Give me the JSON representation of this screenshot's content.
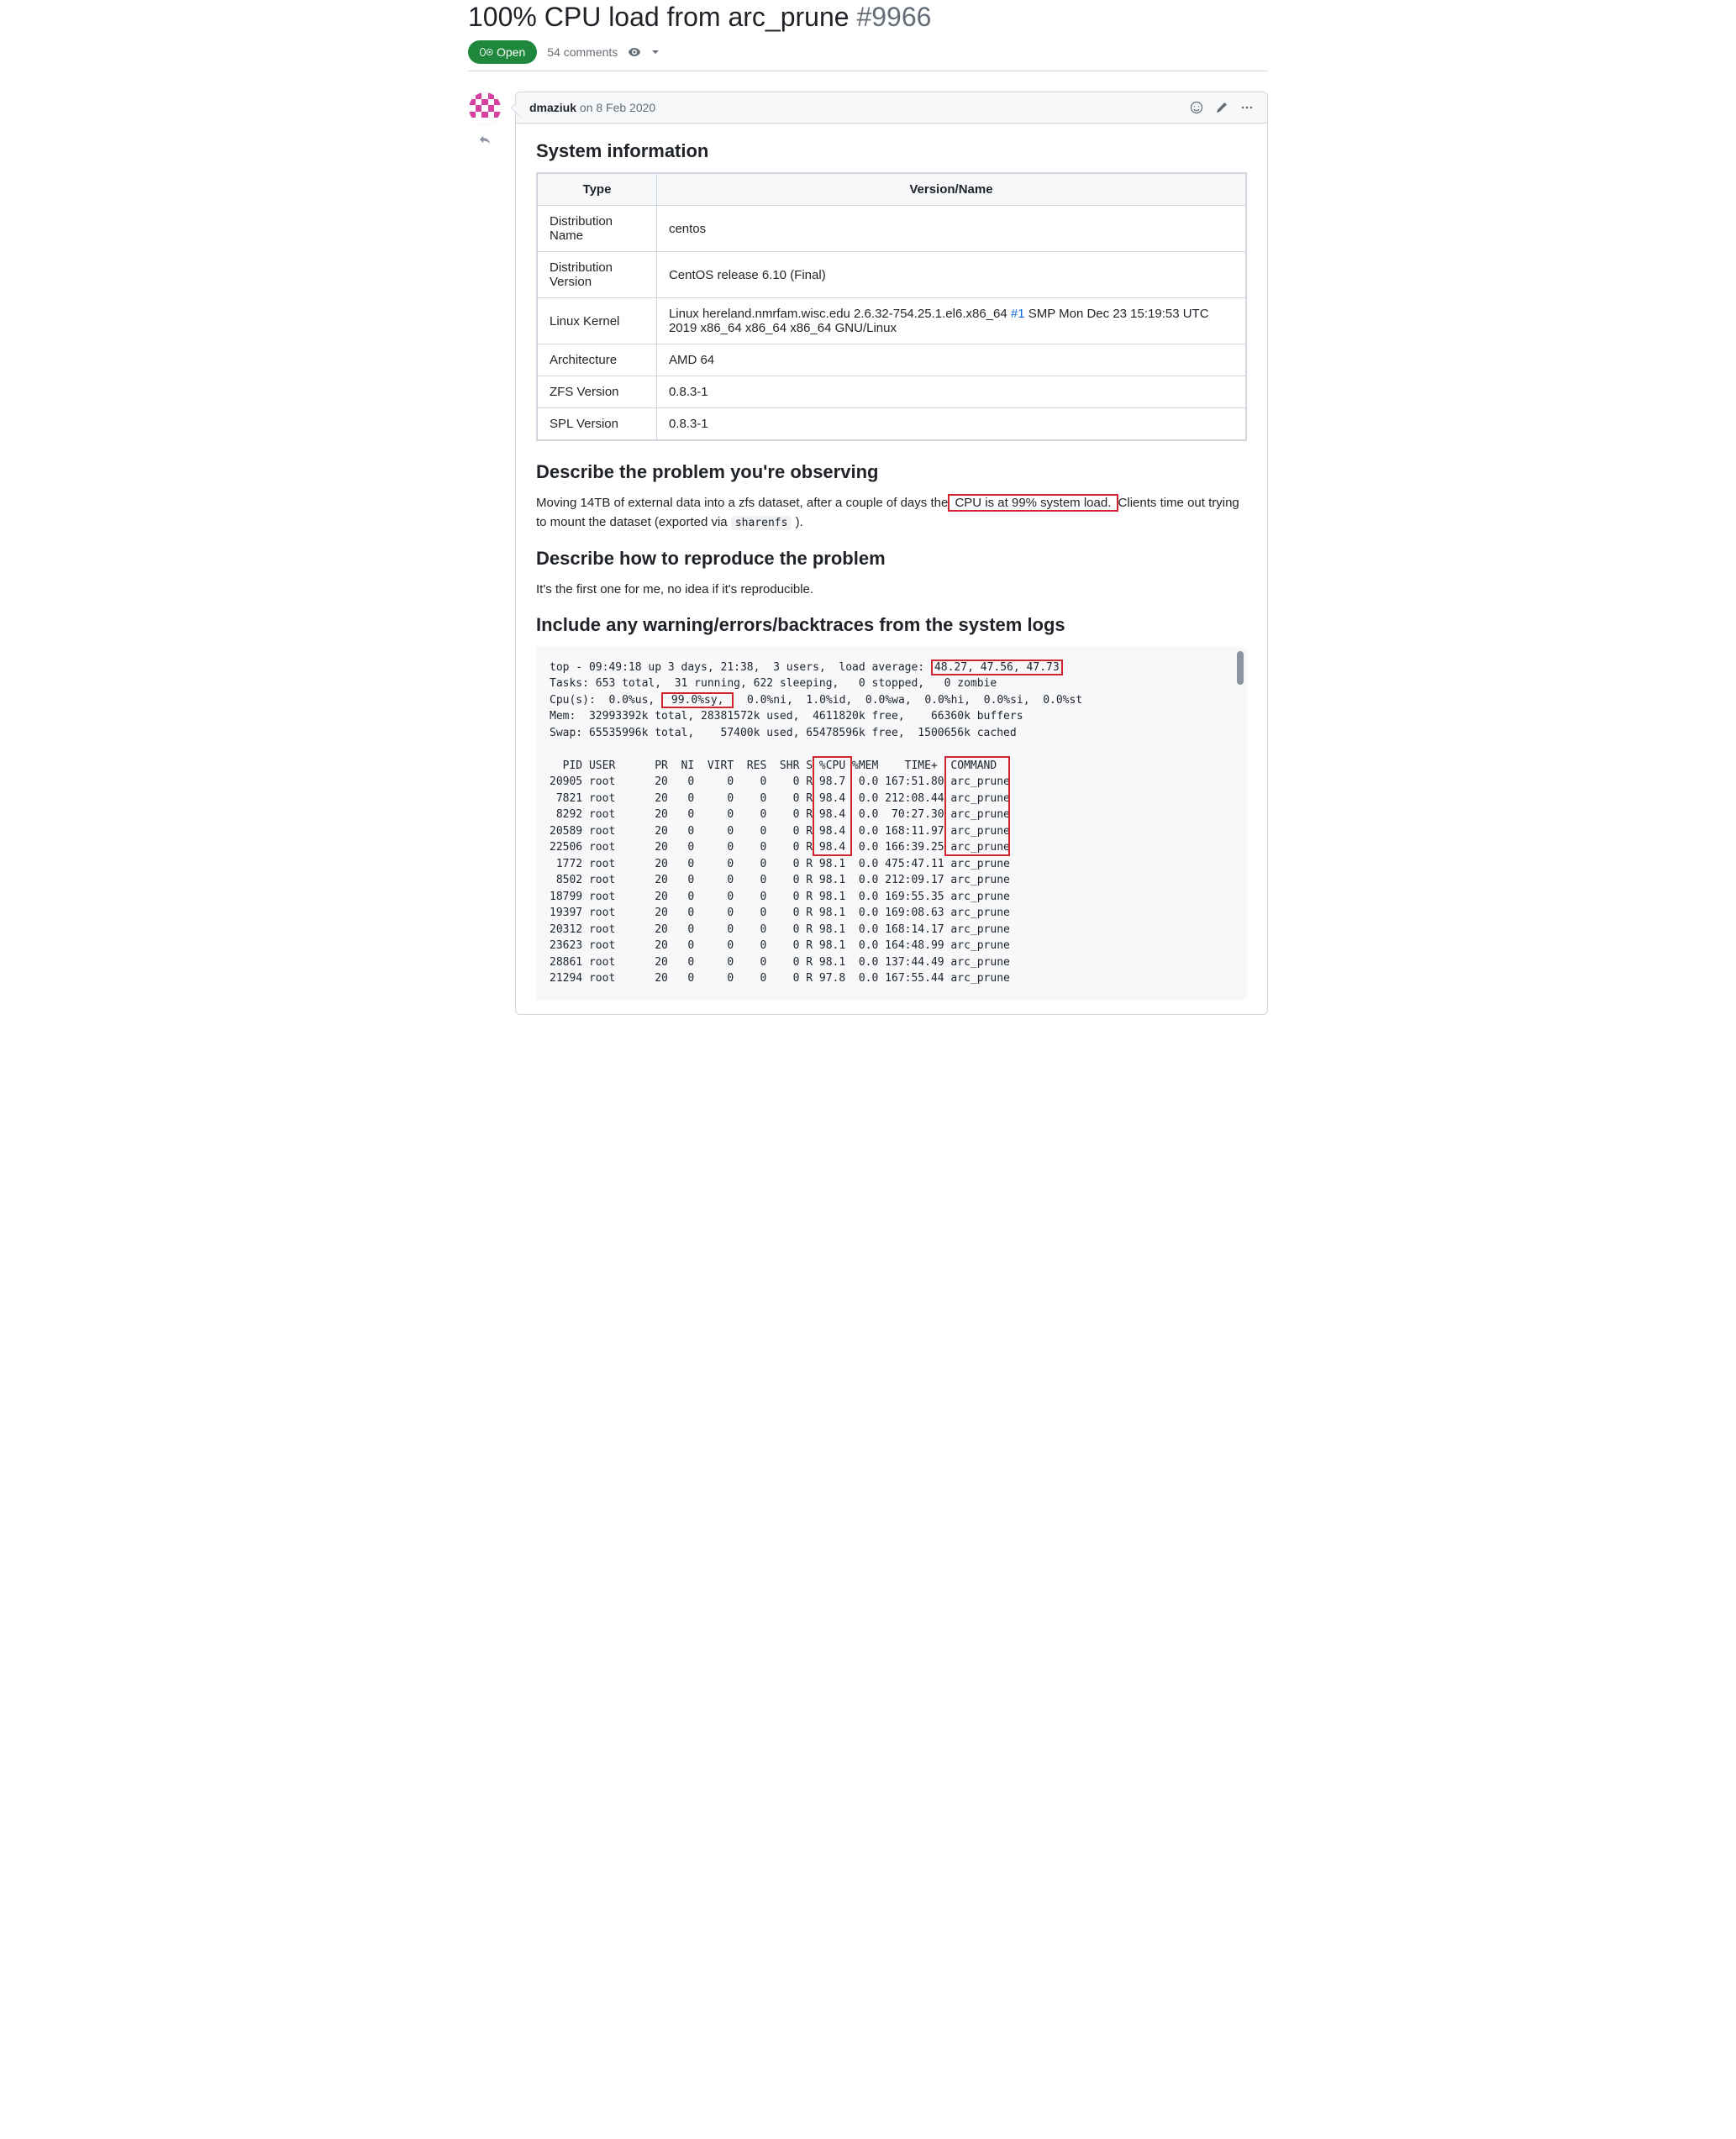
{
  "issue": {
    "title": "100% CPU load from arc_prune",
    "number": "#9966",
    "state": "Open",
    "comments": "54 comments"
  },
  "comment": {
    "author": "dmaziuk",
    "date": "on 8 Feb 2020"
  },
  "headings": {
    "sysinfo": "System information",
    "problem": "Describe the problem you're observing",
    "repro": "Describe how to reproduce the problem",
    "logs": "Include any warning/errors/backtraces from the system logs"
  },
  "table": {
    "h_type": "Type",
    "h_vn": "Version/Name",
    "r0_t": "Distribution Name",
    "r0_v": "centos",
    "r1_t": "Distribution Version",
    "r1_v": "CentOS release 6.10 (Final)",
    "r2_t": "Linux Kernel",
    "r2_v_a": "Linux hereland.nmrfam.wisc.edu 2.6.32-754.25.1.el6.x86_64 ",
    "r2_link": "#1",
    "r2_v_b": " SMP Mon Dec 23 15:19:53 UTC 2019 x86_64 x86_64 x86_64 GNU/Linux",
    "r3_t": "Architecture",
    "r3_v": "AMD 64",
    "r4_t": "ZFS Version",
    "r4_v": "0.8.3-1",
    "r5_t": "SPL Version",
    "r5_v": "0.8.3-1"
  },
  "problem": {
    "p1_a": "Moving 14TB of external data into a zfs dataset, after a couple of days the",
    "p1_hl": " CPU is at 99% system load. ",
    "p1_b": "Clients time out trying to mount the dataset (exported via ",
    "p1_code": "sharenfs",
    "p1_c": " )."
  },
  "repro": {
    "p": "It's the first one for me, no idea if it's reproducible."
  },
  "logs": {
    "l1_a": "top - 09:49:18 up 3 days, 21:38,  3 users,  load average: ",
    "l1_hl": "48.27, 47.56, 47.73",
    "l2": "Tasks: 653 total,  31 running, 622 sleeping,   0 stopped,   0 zombie",
    "l3_a": "Cpu(s):  0.0%us, ",
    "l3_hl": "99.0%sy,",
    "l3_b": "  0.0%ni,  1.0%id,  0.0%wa,  0.0%hi,  0.0%si,  0.0%st",
    "l4": "Mem:  32993392k total, 28381572k used,  4611820k free,    66360k buffers",
    "l5": "Swap: 65535996k total,    57400k used, 65478596k free,  1500656k cached",
    "hdr": "  PID USER      PR  NI  VIRT  RES  SHR S %CPU %MEM    TIME+  COMMAND",
    "rows": [
      "20905 root      20   0     0    0    0 R 98.7  0.0 167:51.80 arc_prune",
      " 7821 root      20   0     0    0    0 R 98.4  0.0 212:08.44 arc_prune",
      " 8292 root      20   0     0    0    0 R 98.4  0.0  70:27.30 arc_prune",
      "20589 root      20   0     0    0    0 R 98.4  0.0 168:11.97 arc_prune",
      "22506 root      20   0     0    0    0 R 98.4  0.0 166:39.25 arc_prune",
      " 1772 root      20   0     0    0    0 R 98.1  0.0 475:47.11 arc_prune",
      " 8502 root      20   0     0    0    0 R 98.1  0.0 212:09.17 arc_prune",
      "18799 root      20   0     0    0    0 R 98.1  0.0 169:55.35 arc_prune",
      "19397 root      20   0     0    0    0 R 98.1  0.0 169:08.63 arc_prune",
      "20312 root      20   0     0    0    0 R 98.1  0.0 168:14.17 arc_prune",
      "23623 root      20   0     0    0    0 R 98.1  0.0 164:48.99 arc_prune",
      "28861 root      20   0     0    0    0 R 98.1  0.0 137:44.49 arc_prune",
      "21294 root      20   0     0    0    0 R 97.8  0.0 167:55.44 arc_prune"
    ]
  }
}
